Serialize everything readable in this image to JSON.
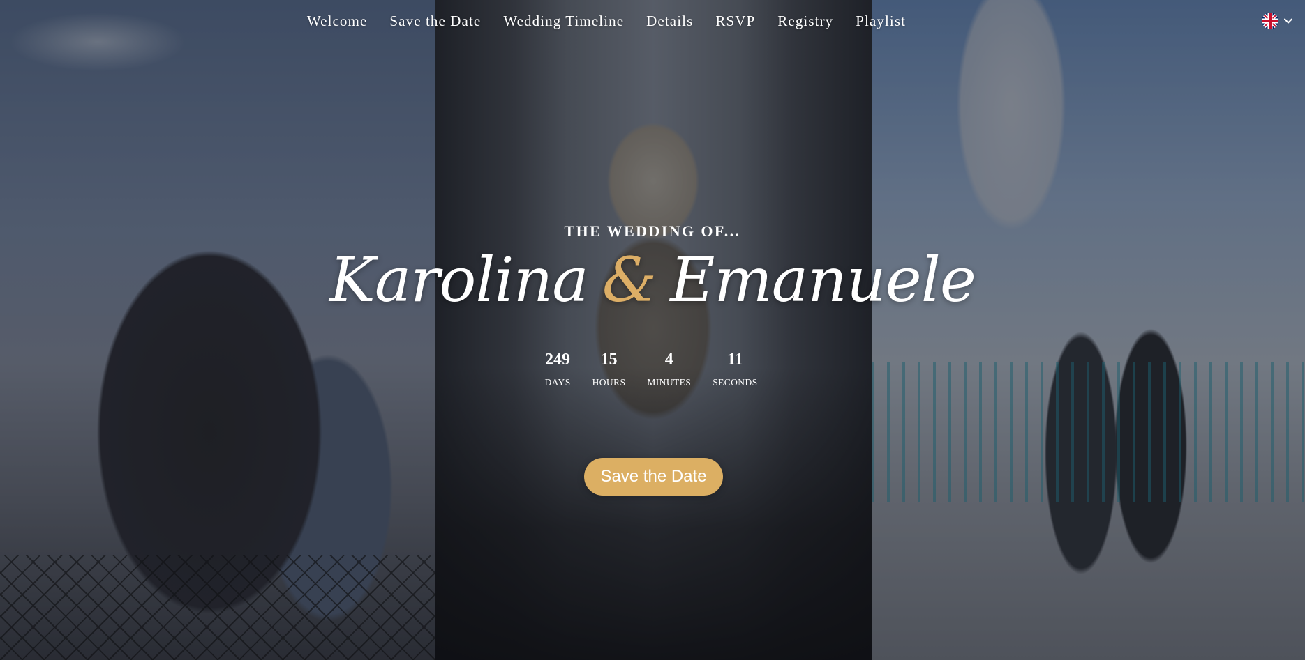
{
  "nav": {
    "items": [
      {
        "label": "Welcome"
      },
      {
        "label": "Save the Date"
      },
      {
        "label": "Wedding Timeline"
      },
      {
        "label": "Details"
      },
      {
        "label": "RSVP"
      },
      {
        "label": "Registry"
      },
      {
        "label": "Playlist"
      }
    ],
    "language_icon": "uk-flag-icon"
  },
  "hero": {
    "eyebrow": "THE WEDDING OF...",
    "name_one": "Karolina",
    "ampersand": "&",
    "name_two": "Emanuele",
    "countdown": [
      {
        "value": "249",
        "label": "DAYS"
      },
      {
        "value": "15",
        "label": "HOURS"
      },
      {
        "value": "4",
        "label": "MINUTES"
      },
      {
        "value": "11",
        "label": "SECONDS"
      }
    ],
    "cta_label": "Save the Date"
  },
  "colors": {
    "accent_gold": "#dcaf63",
    "text": "#ffffff"
  }
}
